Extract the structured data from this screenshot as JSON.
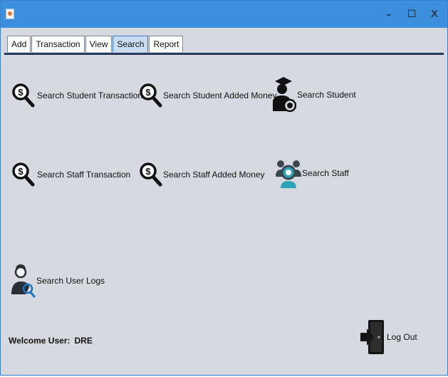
{
  "window": {
    "minimize": "–",
    "maximize": "☐",
    "close": "X"
  },
  "tabs": [
    {
      "label": "Add",
      "active": false
    },
    {
      "label": "Transaction",
      "active": false
    },
    {
      "label": "View",
      "active": false
    },
    {
      "label": "Search",
      "active": true
    },
    {
      "label": "Report",
      "active": false
    }
  ],
  "actions": {
    "student_transaction": {
      "label": "Search Student Transaction",
      "icon": "money-search-icon"
    },
    "student_added_money": {
      "label": "Search Student Added Money",
      "icon": "money-search-icon"
    },
    "student": {
      "label": "Search Student",
      "icon": "student-search-icon"
    },
    "staff_transaction": {
      "label": "Search Staff Transaction",
      "icon": "money-search-icon"
    },
    "staff_added_money": {
      "label": "Search Staff Added Money",
      "icon": "money-search-icon"
    },
    "staff": {
      "label": "Search Staff",
      "icon": "staff-search-icon"
    },
    "user_logs": {
      "label": "Search User Logs",
      "icon": "user-search-icon"
    },
    "logout": {
      "label": "Log Out",
      "icon": "logout-icon"
    }
  },
  "welcome": {
    "label": "Welcome User:",
    "user": "DRE"
  },
  "colors": {
    "titlebar": "#3b8fdc",
    "background": "#d6d9df",
    "accent": "#2ea3b8"
  }
}
